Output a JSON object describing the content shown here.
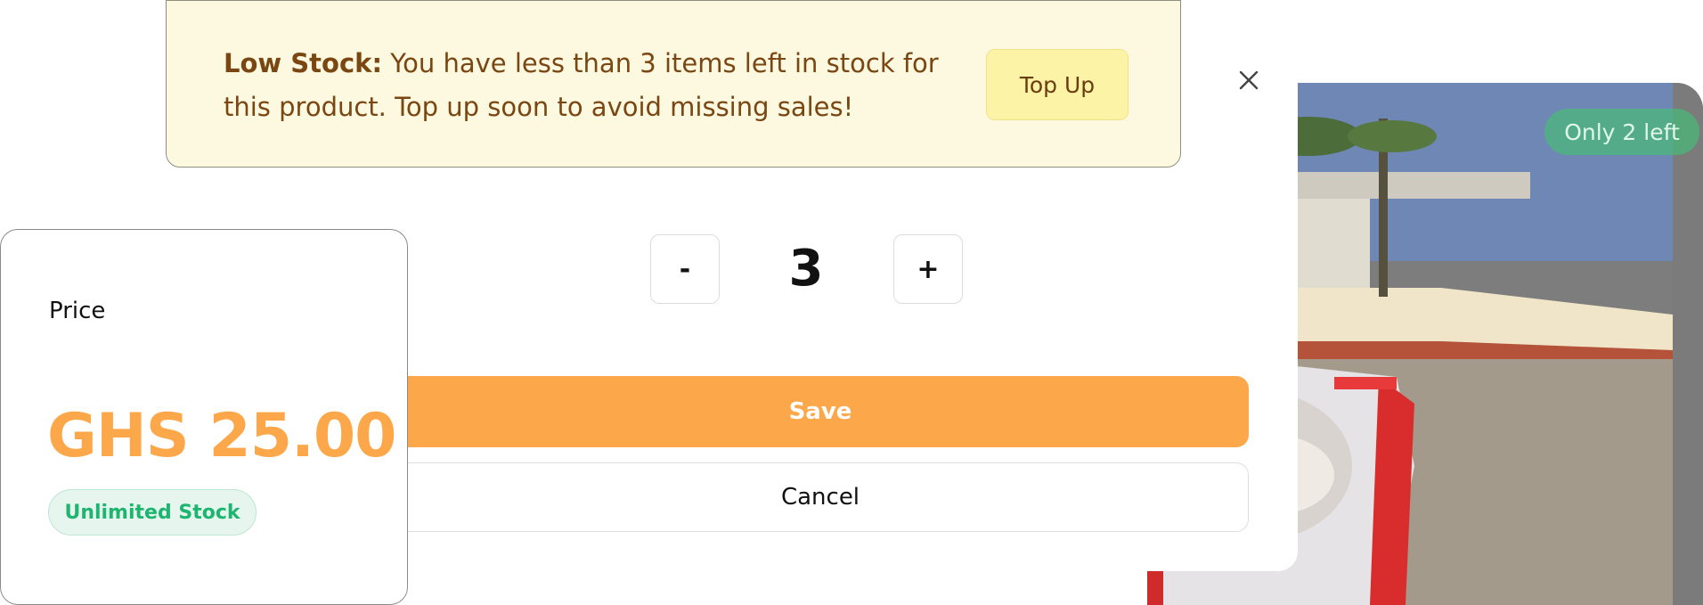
{
  "banner": {
    "title": "Low Stock:",
    "message": "You have less than 3 items left in stock for this product. Top up soon to avoid missing sales!",
    "button_label": "Top Up"
  },
  "product": {
    "stock_badge": "Only 2 left"
  },
  "quantity": {
    "decrement_label": "-",
    "value": "3",
    "increment_label": "+"
  },
  "actions": {
    "save_label": "Save",
    "cancel_label": "Cancel"
  },
  "price_card": {
    "label": "Price",
    "value": "GHS 25.00",
    "stock_status": "Unlimited Stock"
  },
  "colors": {
    "accent": "#fca84a",
    "banner_bg": "#fdf9e1",
    "banner_text": "#7a4612",
    "success": "#1db56f"
  },
  "icons": {
    "close": "close-icon"
  }
}
